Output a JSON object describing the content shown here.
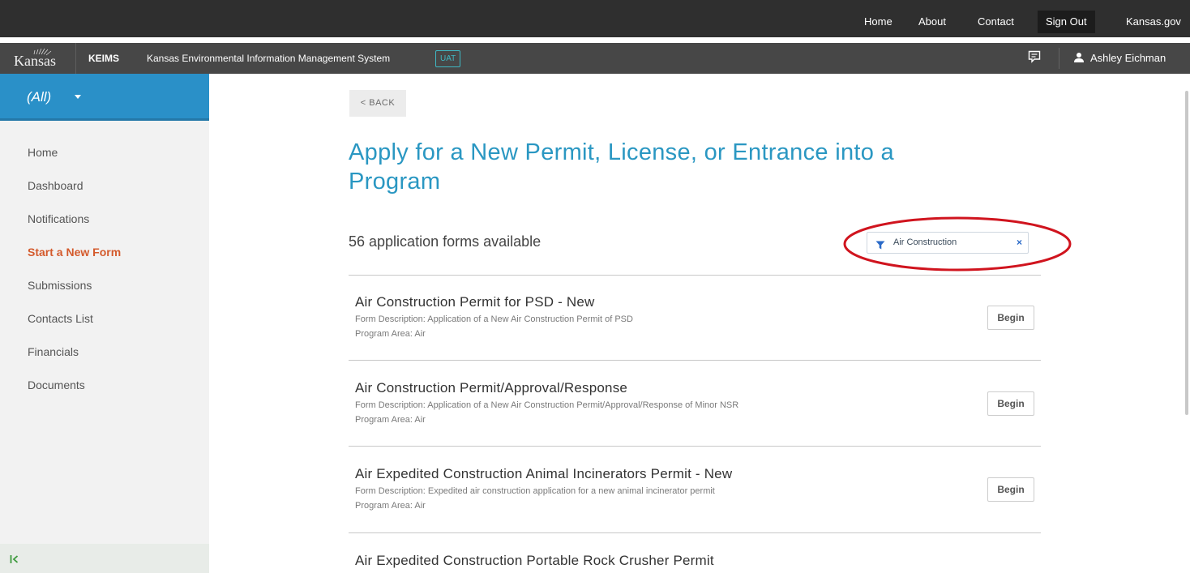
{
  "top_nav": {
    "links": [
      "Home",
      "About",
      "Contact"
    ],
    "sign_out": "Sign Out",
    "state_site": "Kansas.gov"
  },
  "app_bar": {
    "logo_text": "Kansas",
    "app_abbr": "KEIMS",
    "app_name": "Kansas Environmental Information Management System",
    "environment": "UAT",
    "user_name": "Ashley Eichman"
  },
  "sidebar": {
    "filter_label": "(All)",
    "items": [
      {
        "label": "Home"
      },
      {
        "label": "Dashboard"
      },
      {
        "label": "Notifications"
      },
      {
        "label": "Start a New Form"
      },
      {
        "label": "Submissions"
      },
      {
        "label": "Contacts List"
      },
      {
        "label": "Financials"
      },
      {
        "label": "Documents"
      }
    ],
    "active_item": "Start a New Form"
  },
  "main": {
    "back_label": "< BACK",
    "title": "Apply for a New Permit, License, or Entrance into a Program",
    "count_text": "56 application forms available",
    "active_filter": "Air Construction",
    "forms": [
      {
        "title": "Air Construction Permit for PSD - New",
        "description": "Form Description: Application of a New Air Construction Permit of PSD",
        "program_area": "Program Area: Air",
        "action": "Begin"
      },
      {
        "title": "Air Construction Permit/Approval/Response",
        "description": "Form Description: Application of a New Air Construction Permit/Approval/Response of Minor NSR",
        "program_area": "Program Area: Air",
        "action": "Begin"
      },
      {
        "title": "Air Expedited Construction Animal Incinerators Permit - New",
        "description": "Form Description: Expedited air construction application for a new animal incinerator permit",
        "program_area": "Program Area: Air",
        "action": "Begin"
      },
      {
        "title": "Air Expedited Construction Portable Rock Crusher Permit"
      }
    ]
  },
  "colors": {
    "top_bar": "#2f2f2f",
    "app_bar": "#474747",
    "accent_blue": "#2a97c2",
    "sidebar_filter": "#2a90c8",
    "active_nav": "#d45a2c",
    "annotation_red": "#d0141e"
  }
}
